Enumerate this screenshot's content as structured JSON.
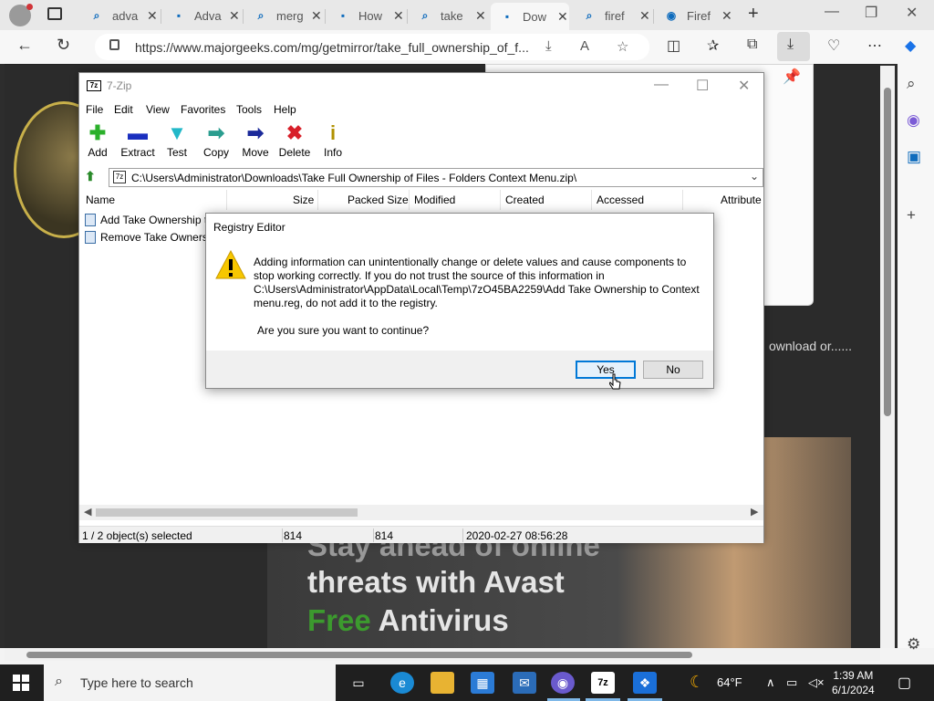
{
  "browser": {
    "tabs": [
      {
        "label": "adva",
        "icon": "search-icon"
      },
      {
        "label": "Adva",
        "icon": "site-logo-icon"
      },
      {
        "label": "merg",
        "icon": "search-icon"
      },
      {
        "label": "How",
        "icon": "site-logo-icon"
      },
      {
        "label": "take",
        "icon": "search-icon"
      },
      {
        "label": "Dow",
        "icon": "majorgeeks-icon"
      },
      {
        "label": "firef",
        "icon": "search-icon"
      },
      {
        "label": "Firef",
        "icon": "firefox-icon"
      }
    ],
    "url": "https://www.majorgeeks.com/mg/getmirror/take_full_ownership_of_f..."
  },
  "webpage": {
    "site_text": "ownload or......",
    "ad_line1": "Stay ahead of online",
    "ad_line2": "threats with Avast",
    "ad_free": "Free",
    "ad_antivirus": " Antivirus"
  },
  "sevenzip": {
    "title": "7-Zip",
    "logo": "7z",
    "menu": [
      "File",
      "Edit",
      "View",
      "Favorites",
      "Tools",
      "Help"
    ],
    "toolbar": [
      {
        "label": "Add",
        "glyph": "✚",
        "color": "#2bb02b"
      },
      {
        "label": "Extract",
        "glyph": "▬",
        "color": "#1a2fbf"
      },
      {
        "label": "Test",
        "glyph": "▼",
        "color": "#22b8c8"
      },
      {
        "label": "Copy",
        "glyph": "➡",
        "color": "#2a9d8f"
      },
      {
        "label": "Move",
        "glyph": "➡",
        "color": "#1b2a9a"
      },
      {
        "label": "Delete",
        "glyph": "✖",
        "color": "#d8202a"
      },
      {
        "label": "Info",
        "glyph": "i",
        "color": "#b09000"
      }
    ],
    "path": "C:\\Users\\Administrator\\Downloads\\Take Full Ownership of Files - Folders Context Menu.zip\\",
    "columns": [
      "Name",
      "Size",
      "Packed Size",
      "Modified",
      "Created",
      "Accessed",
      "Attribute"
    ],
    "files": [
      {
        "name": "Add Take Ownership t"
      },
      {
        "name": "Remove Take Ownersh"
      }
    ],
    "status": {
      "selected": "1 / 2 object(s) selected",
      "size": "814",
      "packed": "814",
      "modified": "2020-02-27 08:56:28"
    }
  },
  "dialog": {
    "title": "Registry Editor",
    "message": "Adding information can unintentionally change or delete values and cause components to stop working correctly. If you do not trust the source of this information in C:\\Users\\Administrator\\AppData\\Local\\Temp\\7zO45BA2259\\Add Take Ownership to Context menu.reg, do not add it to the registry.",
    "question": "Are you sure you want to continue?",
    "yes": "Yes",
    "no": "No"
  },
  "taskbar": {
    "search_placeholder": "Type here to search",
    "weather": "64°F",
    "time": "1:39 AM",
    "date": "6/1/2024"
  }
}
